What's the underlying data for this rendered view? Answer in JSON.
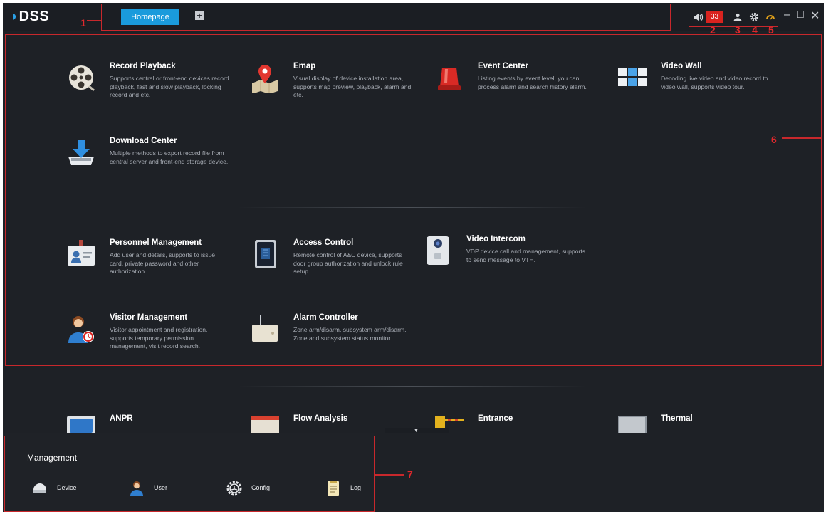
{
  "app": {
    "logo": "DSS"
  },
  "tabs": {
    "homepage": "Homepage",
    "add": "+"
  },
  "toolbar": {
    "alarm_count": "33"
  },
  "window_controls": {
    "minimize": "–",
    "maximize": "□",
    "close": "✕"
  },
  "annotations": [
    "1",
    "2",
    "3",
    "4",
    "5",
    "6",
    "7"
  ],
  "modules": [
    {
      "title": "Record Playback",
      "desc": "Supports central or front-end devices record playback, fast and slow playback, locking record and etc.",
      "icon": "film-reel-icon"
    },
    {
      "title": "Emap",
      "desc": "Visual display of device installation area, supports map preview, playback, alarm and etc.",
      "icon": "map-pin-icon"
    },
    {
      "title": "Event Center",
      "desc": "Listing events by event level, you can process alarm and search history alarm.",
      "icon": "alarm-light-icon"
    },
    {
      "title": "Video Wall",
      "desc": "Decoding live video and video record to video wall, supports video tour.",
      "icon": "video-wall-icon"
    },
    {
      "title": "Download Center",
      "desc": "Multiple methods to export record file from central server and front-end storage device.",
      "icon": "download-icon"
    },
    {
      "title": "Personnel Management",
      "desc": "Add user and details, supports to issue card, private password and other authorization.",
      "icon": "id-card-icon"
    },
    {
      "title": "Access Control",
      "desc": "Remote control of A&C device, supports door group authorization and unlock rule setup.",
      "icon": "access-panel-icon"
    },
    {
      "title": "Video Intercom",
      "desc": "VDP device call and management, supports to send message to VTH.",
      "icon": "intercom-icon"
    },
    {
      "title": "Visitor Management",
      "desc": "Visitor appointment and registration, supports temporary permission management, visit record search.",
      "icon": "visitor-icon"
    },
    {
      "title": "Alarm Controller",
      "desc": "Zone arm/disarm, subsystem arm/disarm, Zone and subsystem status monitor.",
      "icon": "alarm-controller-icon"
    },
    {
      "title": "ANPR",
      "desc": "",
      "icon": "anpr-icon"
    },
    {
      "title": "Flow Analysis",
      "desc": "",
      "icon": "flow-analysis-icon"
    },
    {
      "title": "Entrance",
      "desc": "",
      "icon": "entrance-icon"
    },
    {
      "title": "Thermal",
      "desc": "",
      "icon": "thermal-icon"
    }
  ],
  "management": {
    "title": "Management",
    "items": [
      {
        "label": "Device",
        "icon": "device-icon"
      },
      {
        "label": "User",
        "icon": "user-icon"
      },
      {
        "label": "Config",
        "icon": "config-icon"
      },
      {
        "label": "Log",
        "icon": "log-icon"
      }
    ]
  },
  "colors": {
    "accent": "#1a9bdc",
    "annotation": "#c8282c",
    "background": "#1e2126",
    "alarm": "#d9231f"
  }
}
